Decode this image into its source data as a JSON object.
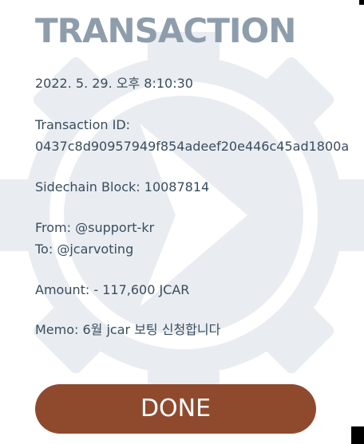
{
  "dialog": {
    "title": "TRANSACTION",
    "datetime": "2022. 5. 29. 오후 8:10:30",
    "transaction_id_label": "Transaction ID:",
    "transaction_id": "0437c8d90957949f854adeef20e446c45ad1800a",
    "sidechain_block": "Sidechain Block: 10087814",
    "from": "From: @support-kr",
    "to": "To: @jcarvoting",
    "amount": "Amount: - 117,600 JCAR",
    "memo": "Memo: 6월 jcar 보팅 신청합니다",
    "done_label": "DONE"
  },
  "colors": {
    "title": "#8e9dac",
    "text": "#3a4c5d",
    "button_bg": "#8f4a2e",
    "button_text": "#ffffff",
    "watermark": "#e9edf1"
  },
  "icons": {
    "watermark": "gear-play-logo-icon"
  }
}
